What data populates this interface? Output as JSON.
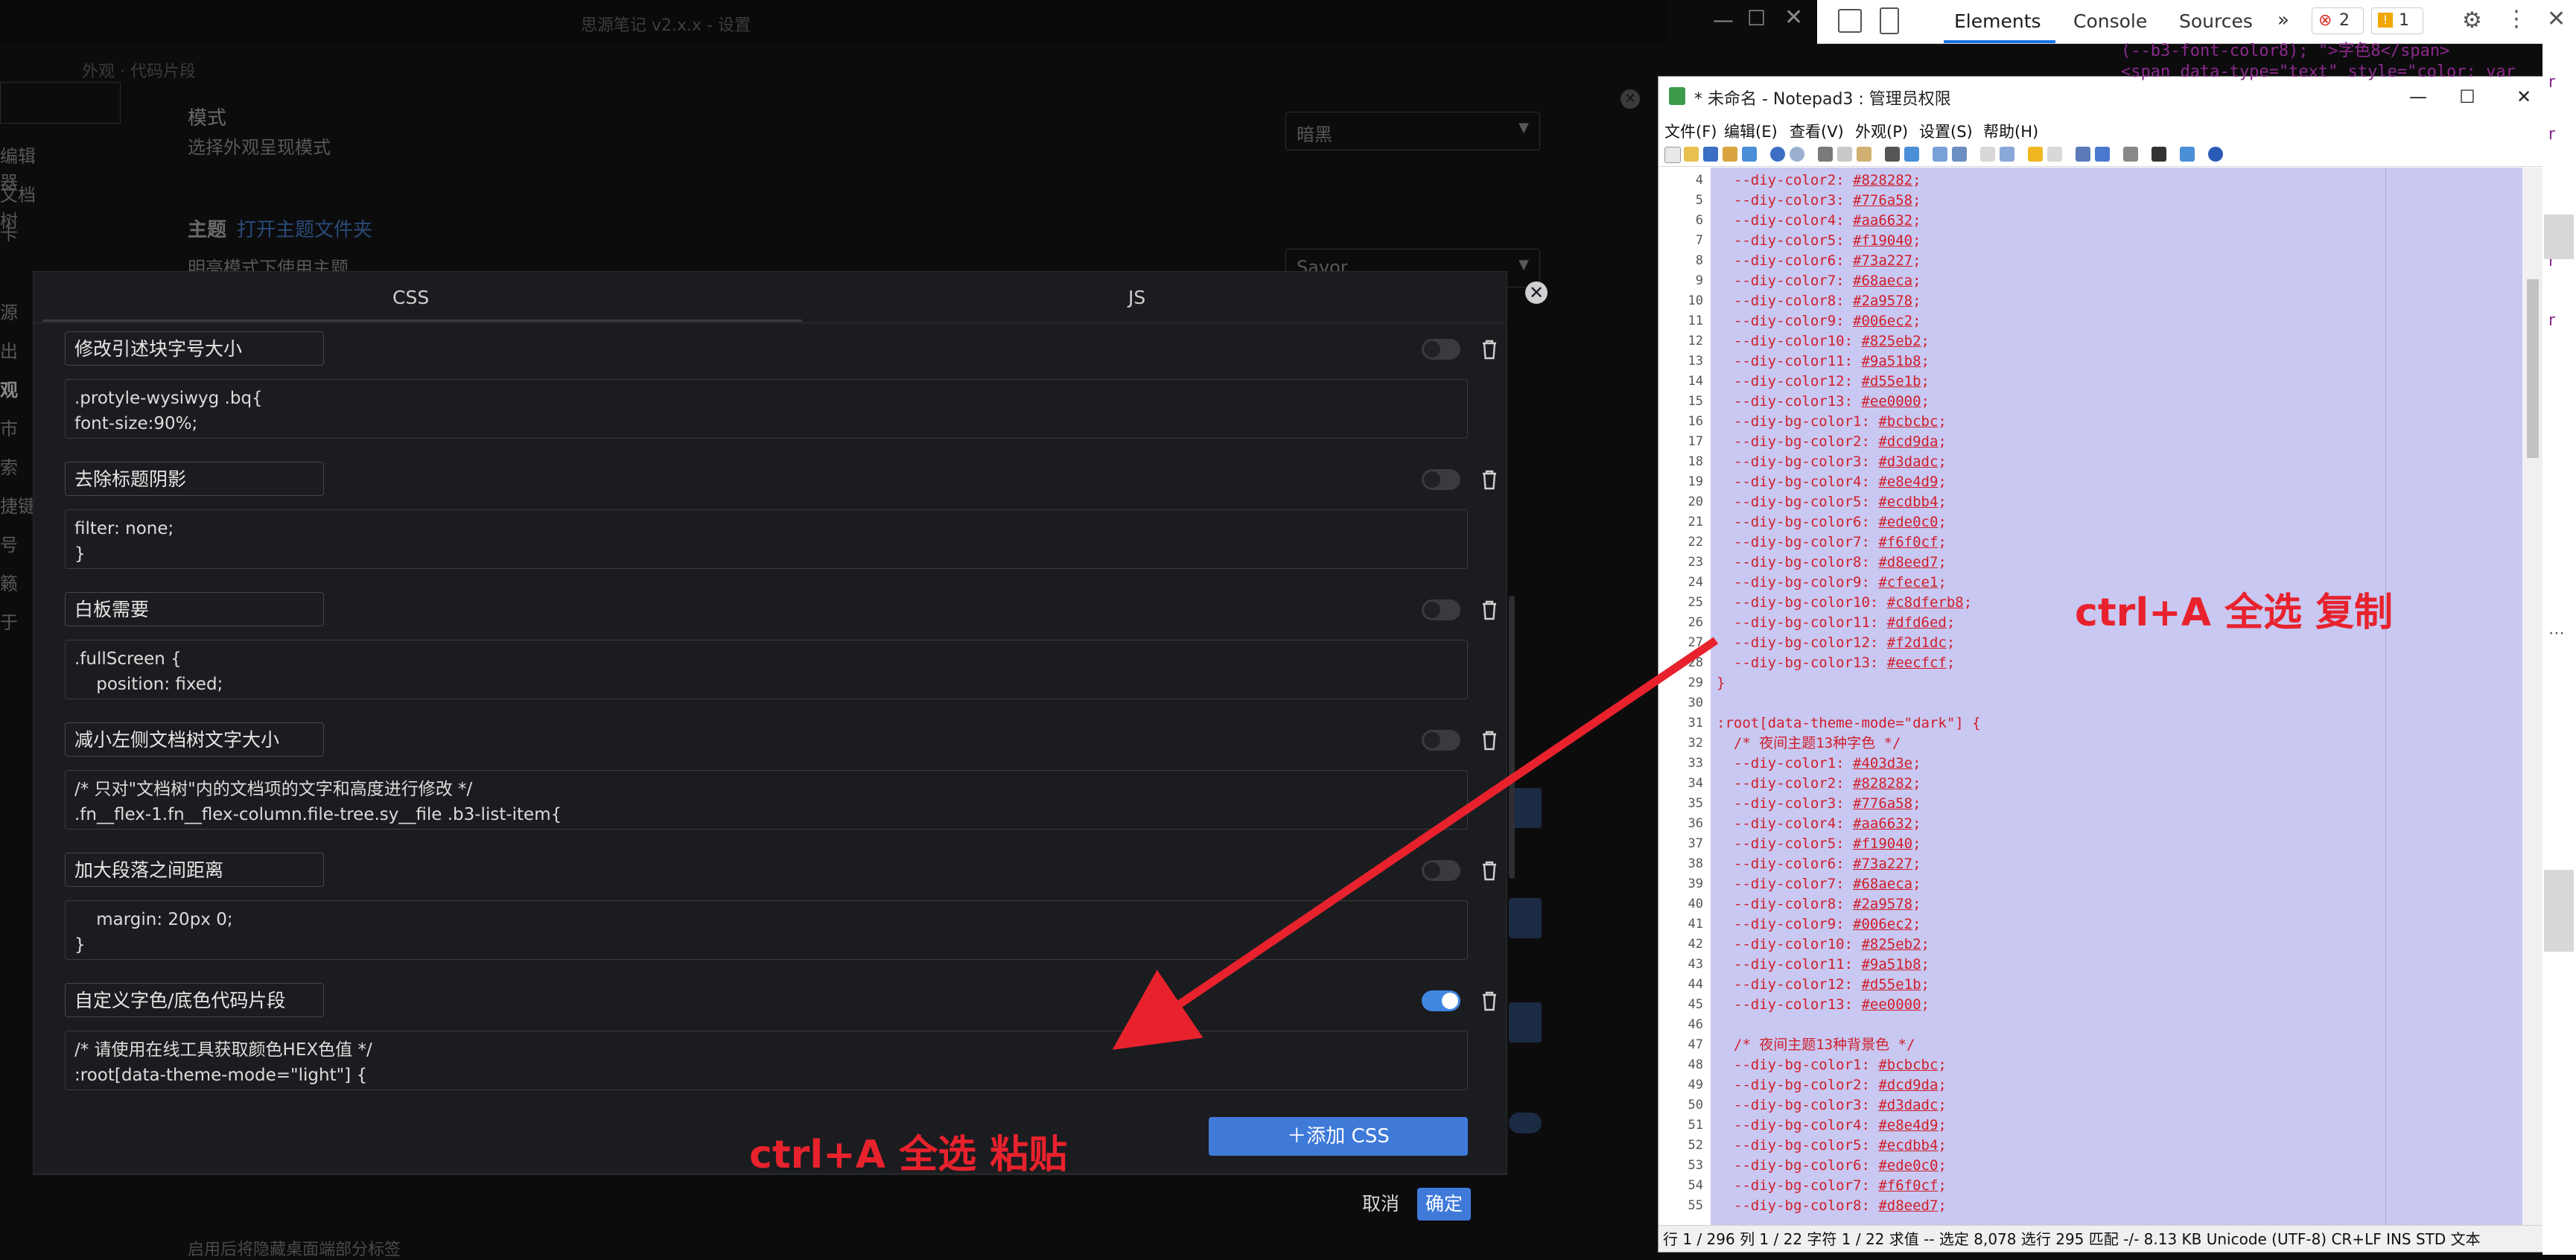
{
  "background_app": {
    "window_title": "思源笔记 v2.x.x - 设置",
    "breadcrumb": "外观 · 代码片段",
    "sidebar_items": [
      "编辑器",
      "文档树",
      "卡",
      "源",
      "出",
      "观",
      "市",
      "索",
      "捷键",
      "号",
      "籁",
      "于"
    ],
    "settings": [
      {
        "title": "模式",
        "desc": "选择外观呈现模式",
        "value": "暗黑"
      },
      {
        "title": "主题",
        "link": "打开主题文件夹",
        "desc": "明亮模式下使用主题",
        "value": "Savor"
      }
    ],
    "footer_text": "启用后将隐藏桌面端部分标签"
  },
  "dialog": {
    "tabs": [
      "CSS",
      "JS"
    ],
    "snippets": [
      {
        "name": "修改引述块字号大小",
        "code": ".protyle-wysiwyg .bq{\nfont-size:90%;",
        "enabled": false
      },
      {
        "name": "去除标题阴影",
        "code": "filter: none;\n}",
        "enabled": false
      },
      {
        "name": "白板需要",
        "code": ".fullScreen {\n    position: fixed;",
        "enabled": false
      },
      {
        "name": "减小左侧文档树文字大小",
        "code": "/* 只对\"文档树\"内的文档项的文字和高度进行修改 */\n.fn__flex-1.fn__flex-column.file-tree.sy__file .b3-list-item{",
        "enabled": false
      },
      {
        "name": "加大段落之间距离",
        "code": "    margin: 20px 0;\n}",
        "enabled": false
      },
      {
        "name": "自定义字色/底色代码片段",
        "code": "/* 请使用在线工具获取颜色HEX色值 */\n:root[data-theme-mode=\"light\"] {",
        "enabled": true
      }
    ],
    "add_button": "添加 CSS",
    "cancel_button": "取消",
    "ok_button": "确定"
  },
  "notepad": {
    "title": "* 未命名 - Notepad3 : 管理员权限",
    "menus": [
      "文件(F)",
      "编辑(E)",
      "查看(V)",
      "外观(P)",
      "设置(S)",
      "帮助(H)"
    ],
    "lines": [
      {
        "n": "4",
        "key": "  --diy-color2: ",
        "val": "#828282"
      },
      {
        "n": "5",
        "key": "  --diy-color3: ",
        "val": "#776a58"
      },
      {
        "n": "6",
        "key": "  --diy-color4: ",
        "val": "#aa6632"
      },
      {
        "n": "7",
        "key": "  --diy-color5: ",
        "val": "#f19040"
      },
      {
        "n": "8",
        "key": "  --diy-color6: ",
        "val": "#73a227"
      },
      {
        "n": "9",
        "key": "  --diy-color7: ",
        "val": "#68aeca"
      },
      {
        "n": "10",
        "key": "  --diy-color8: ",
        "val": "#2a9578"
      },
      {
        "n": "11",
        "key": "  --diy-color9: ",
        "val": "#006ec2"
      },
      {
        "n": "12",
        "key": "  --diy-color10: ",
        "val": "#825eb2"
      },
      {
        "n": "13",
        "key": "  --diy-color11: ",
        "val": "#9a51b8"
      },
      {
        "n": "14",
        "key": "  --diy-color12: ",
        "val": "#d55e1b"
      },
      {
        "n": "15",
        "key": "  --diy-color13: ",
        "val": "#ee0000"
      },
      {
        "n": "16",
        "key": "  --diy-bg-color1: ",
        "val": "#bcbcbc"
      },
      {
        "n": "17",
        "key": "  --diy-bg-color2: ",
        "val": "#dcd9da"
      },
      {
        "n": "18",
        "key": "  --diy-bg-color3: ",
        "val": "#d3dadc"
      },
      {
        "n": "19",
        "key": "  --diy-bg-color4: ",
        "val": "#e8e4d9"
      },
      {
        "n": "20",
        "key": "  --diy-bg-color5: ",
        "val": "#ecdbb4"
      },
      {
        "n": "21",
        "key": "  --diy-bg-color6: ",
        "val": "#ede0c0"
      },
      {
        "n": "22",
        "key": "  --diy-bg-color7: ",
        "val": "#f6f0cf"
      },
      {
        "n": "23",
        "key": "  --diy-bg-color8: ",
        "val": "#d8eed7"
      },
      {
        "n": "24",
        "key": "  --diy-bg-color9: ",
        "val": "#cfece1"
      },
      {
        "n": "25",
        "key": "  --diy-bg-color10: ",
        "val": "#c8dferb8"
      },
      {
        "n": "26",
        "key": "  --diy-bg-color11: ",
        "val": "#dfd6ed"
      },
      {
        "n": "27",
        "key": "  --diy-bg-color12: ",
        "val": "#f2d1dc"
      },
      {
        "n": "28",
        "key": "  --diy-bg-color13: ",
        "val": "#eecfcf"
      },
      {
        "n": "29",
        "key": "}",
        "val": ""
      },
      {
        "n": "30",
        "key": "",
        "val": ""
      },
      {
        "n": "31",
        "key": ":root[data-theme-mode=\"dark\"] {",
        "val": ""
      },
      {
        "n": "32",
        "key": "  /* 夜间主题13种字色 */",
        "val": ""
      },
      {
        "n": "33",
        "key": "  --diy-color1: ",
        "val": "#403d3e"
      },
      {
        "n": "34",
        "key": "  --diy-color2: ",
        "val": "#828282"
      },
      {
        "n": "35",
        "key": "  --diy-color3: ",
        "val": "#776a58"
      },
      {
        "n": "36",
        "key": "  --diy-color4: ",
        "val": "#aa6632"
      },
      {
        "n": "37",
        "key": "  --diy-color5: ",
        "val": "#f19040"
      },
      {
        "n": "38",
        "key": "  --diy-color6: ",
        "val": "#73a227"
      },
      {
        "n": "39",
        "key": "  --diy-color7: ",
        "val": "#68aeca"
      },
      {
        "n": "40",
        "key": "  --diy-color8: ",
        "val": "#2a9578"
      },
      {
        "n": "41",
        "key": "  --diy-color9: ",
        "val": "#006ec2"
      },
      {
        "n": "42",
        "key": "  --diy-color10: ",
        "val": "#825eb2"
      },
      {
        "n": "43",
        "key": "  --diy-color11: ",
        "val": "#9a51b8"
      },
      {
        "n": "44",
        "key": "  --diy-color12: ",
        "val": "#d55e1b"
      },
      {
        "n": "45",
        "key": "  --diy-color13: ",
        "val": "#ee0000"
      },
      {
        "n": "46",
        "key": "",
        "val": ""
      },
      {
        "n": "47",
        "key": "  /* 夜间主题13种背景色 */",
        "val": ""
      },
      {
        "n": "48",
        "key": "  --diy-bg-color1: ",
        "val": "#bcbcbc"
      },
      {
        "n": "49",
        "key": "  --diy-bg-color2: ",
        "val": "#dcd9da"
      },
      {
        "n": "50",
        "key": "  --diy-bg-color3: ",
        "val": "#d3dadc"
      },
      {
        "n": "51",
        "key": "  --diy-bg-color4: ",
        "val": "#e8e4d9"
      },
      {
        "n": "52",
        "key": "  --diy-bg-color5: ",
        "val": "#ecdbb4"
      },
      {
        "n": "53",
        "key": "  --diy-bg-color6: ",
        "val": "#ede0c0"
      },
      {
        "n": "54",
        "key": "  --diy-bg-color7: ",
        "val": "#f6f0cf"
      },
      {
        "n": "55",
        "key": "  --diy-bg-color8: ",
        "val": "#d8eed7"
      }
    ],
    "status_bar": "行 1 / 296  列 1 / 22  字符 1 / 22  求值 --  选定 8,078  选行 295  匹配 -/-  8.13 KB  Unicode (UTF-8)  CR+LF  INS  STD  文本"
  },
  "devtools": {
    "tabs": [
      "Elements",
      "Console",
      "Sources"
    ],
    "error_count": "2",
    "warning_count": "1",
    "code_snippet_1": "(--b3-font-color8); \">字色8</span>",
    "code_snippet_2": "<span data-type=\"text\" style=\"color: var"
  },
  "annotations": {
    "copy": "ctrl+A 全选 复制",
    "paste": "ctrl+A 全选 粘贴"
  },
  "colors": {
    "accent": "#3f7ad9",
    "annotation": "#e8222d",
    "selection": "#c8c8f2"
  }
}
